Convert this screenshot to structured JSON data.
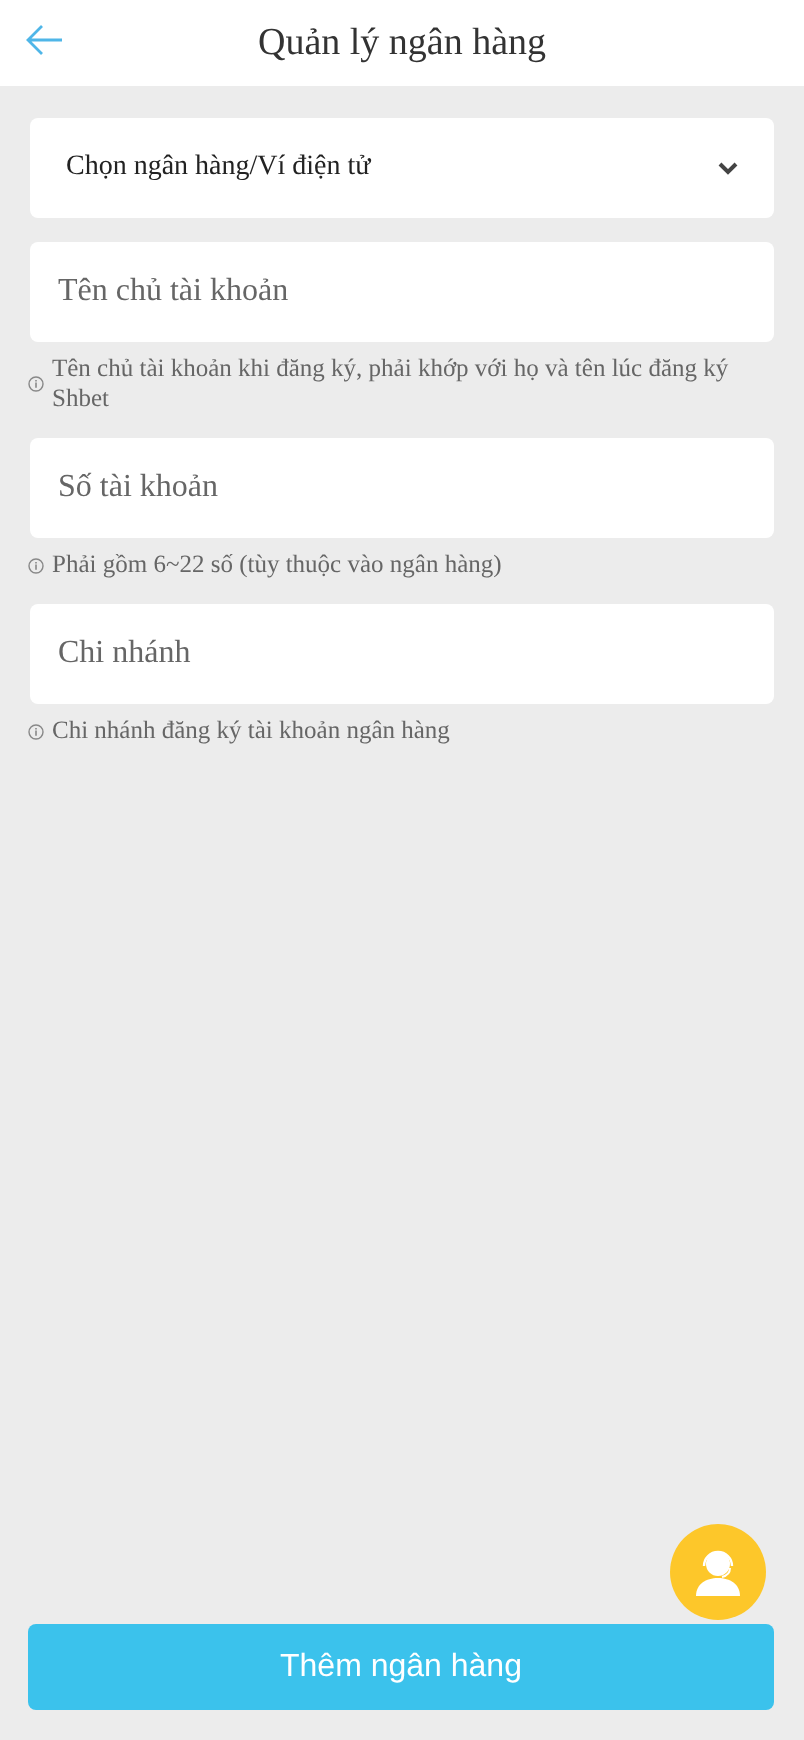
{
  "header": {
    "title": "Quản lý ngân hàng"
  },
  "bank_select": {
    "placeholder": "Chọn ngân hàng/Ví điện tử"
  },
  "fields": [
    {
      "placeholder": "Tên chủ tài khoản",
      "hint": "Tên chủ tài khoản khi đăng ký, phải khớp với họ và tên lúc đăng ký Shbet"
    },
    {
      "placeholder": "Số tài khoản",
      "hint": "Phải gồm 6~22 số (tùy thuộc vào ngân hàng)"
    },
    {
      "placeholder": "Chi nhánh",
      "hint": "Chi nhánh đăng ký tài khoản ngân hàng"
    }
  ],
  "submit_button": "Thêm ngân hàng"
}
